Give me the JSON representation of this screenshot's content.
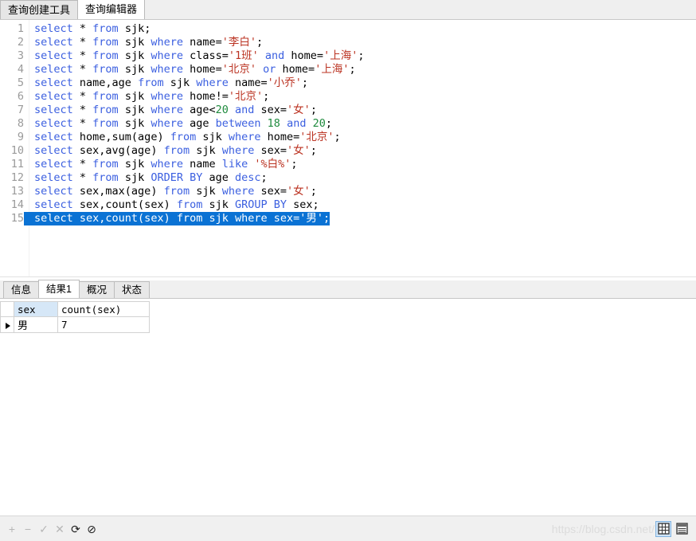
{
  "window": {
    "tabs": [
      {
        "label": "查询创建工具",
        "active": false
      },
      {
        "label": "查询编辑器",
        "active": true
      }
    ]
  },
  "editor": {
    "selected_line": 15,
    "lines": [
      {
        "n": "1",
        "tokens": [
          {
            "t": "select",
            "c": "kw"
          },
          {
            "t": " * ",
            "c": "pln"
          },
          {
            "t": "from",
            "c": "kw"
          },
          {
            "t": " sjk;",
            "c": "pln"
          }
        ]
      },
      {
        "n": "2",
        "tokens": [
          {
            "t": "select",
            "c": "kw"
          },
          {
            "t": " * ",
            "c": "pln"
          },
          {
            "t": "from",
            "c": "kw"
          },
          {
            "t": " sjk ",
            "c": "pln"
          },
          {
            "t": "where",
            "c": "kw"
          },
          {
            "t": " name=",
            "c": "pln"
          },
          {
            "t": "'李白'",
            "c": "str"
          },
          {
            "t": ";",
            "c": "pln"
          }
        ]
      },
      {
        "n": "3",
        "tokens": [
          {
            "t": "select",
            "c": "kw"
          },
          {
            "t": " * ",
            "c": "pln"
          },
          {
            "t": "from",
            "c": "kw"
          },
          {
            "t": " sjk ",
            "c": "pln"
          },
          {
            "t": "where",
            "c": "kw"
          },
          {
            "t": " class=",
            "c": "pln"
          },
          {
            "t": "'1班'",
            "c": "str"
          },
          {
            "t": " ",
            "c": "pln"
          },
          {
            "t": "and",
            "c": "kw"
          },
          {
            "t": " home=",
            "c": "pln"
          },
          {
            "t": "'上海'",
            "c": "str"
          },
          {
            "t": ";",
            "c": "pln"
          }
        ]
      },
      {
        "n": "4",
        "tokens": [
          {
            "t": "select",
            "c": "kw"
          },
          {
            "t": " * ",
            "c": "pln"
          },
          {
            "t": "from",
            "c": "kw"
          },
          {
            "t": " sjk ",
            "c": "pln"
          },
          {
            "t": "where",
            "c": "kw"
          },
          {
            "t": " home=",
            "c": "pln"
          },
          {
            "t": "'北京'",
            "c": "str"
          },
          {
            "t": " ",
            "c": "pln"
          },
          {
            "t": "or",
            "c": "kw"
          },
          {
            "t": " home=",
            "c": "pln"
          },
          {
            "t": "'上海'",
            "c": "str"
          },
          {
            "t": ";",
            "c": "pln"
          }
        ]
      },
      {
        "n": "5",
        "tokens": [
          {
            "t": "select",
            "c": "kw"
          },
          {
            "t": " name,age ",
            "c": "pln"
          },
          {
            "t": "from",
            "c": "kw"
          },
          {
            "t": " sjk ",
            "c": "pln"
          },
          {
            "t": "where",
            "c": "kw"
          },
          {
            "t": " name=",
            "c": "pln"
          },
          {
            "t": "'小乔'",
            "c": "str"
          },
          {
            "t": ";",
            "c": "pln"
          }
        ]
      },
      {
        "n": "6",
        "tokens": [
          {
            "t": "select",
            "c": "kw"
          },
          {
            "t": " * ",
            "c": "pln"
          },
          {
            "t": "from",
            "c": "kw"
          },
          {
            "t": " sjk ",
            "c": "pln"
          },
          {
            "t": "where",
            "c": "kw"
          },
          {
            "t": " home!=",
            "c": "pln"
          },
          {
            "t": "'北京'",
            "c": "str"
          },
          {
            "t": ";",
            "c": "pln"
          }
        ]
      },
      {
        "n": "7",
        "tokens": [
          {
            "t": "select",
            "c": "kw"
          },
          {
            "t": " * ",
            "c": "pln"
          },
          {
            "t": "from",
            "c": "kw"
          },
          {
            "t": " sjk ",
            "c": "pln"
          },
          {
            "t": "where",
            "c": "kw"
          },
          {
            "t": " age<",
            "c": "pln"
          },
          {
            "t": "20",
            "c": "num"
          },
          {
            "t": " ",
            "c": "pln"
          },
          {
            "t": "and",
            "c": "kw"
          },
          {
            "t": " sex=",
            "c": "pln"
          },
          {
            "t": "'女'",
            "c": "str"
          },
          {
            "t": ";",
            "c": "pln"
          }
        ]
      },
      {
        "n": "8",
        "tokens": [
          {
            "t": "select",
            "c": "kw"
          },
          {
            "t": " * ",
            "c": "pln"
          },
          {
            "t": "from",
            "c": "kw"
          },
          {
            "t": " sjk ",
            "c": "pln"
          },
          {
            "t": "where",
            "c": "kw"
          },
          {
            "t": " age ",
            "c": "pln"
          },
          {
            "t": "between",
            "c": "kw"
          },
          {
            "t": " ",
            "c": "pln"
          },
          {
            "t": "18",
            "c": "num"
          },
          {
            "t": " ",
            "c": "pln"
          },
          {
            "t": "and",
            "c": "kw"
          },
          {
            "t": " ",
            "c": "pln"
          },
          {
            "t": "20",
            "c": "num"
          },
          {
            "t": ";",
            "c": "pln"
          }
        ]
      },
      {
        "n": "9",
        "tokens": [
          {
            "t": "select",
            "c": "kw"
          },
          {
            "t": " home,sum(age) ",
            "c": "pln"
          },
          {
            "t": "from",
            "c": "kw"
          },
          {
            "t": " sjk ",
            "c": "pln"
          },
          {
            "t": "where",
            "c": "kw"
          },
          {
            "t": " home=",
            "c": "pln"
          },
          {
            "t": "'北京'",
            "c": "str"
          },
          {
            "t": ";",
            "c": "pln"
          }
        ]
      },
      {
        "n": "10",
        "tokens": [
          {
            "t": "select",
            "c": "kw"
          },
          {
            "t": " sex,avg(age) ",
            "c": "pln"
          },
          {
            "t": "from",
            "c": "kw"
          },
          {
            "t": " sjk ",
            "c": "pln"
          },
          {
            "t": "where",
            "c": "kw"
          },
          {
            "t": " sex=",
            "c": "pln"
          },
          {
            "t": "'女'",
            "c": "str"
          },
          {
            "t": ";",
            "c": "pln"
          }
        ]
      },
      {
        "n": "11",
        "tokens": [
          {
            "t": "select",
            "c": "kw"
          },
          {
            "t": " * ",
            "c": "pln"
          },
          {
            "t": "from",
            "c": "kw"
          },
          {
            "t": " sjk ",
            "c": "pln"
          },
          {
            "t": "where",
            "c": "kw"
          },
          {
            "t": " name ",
            "c": "pln"
          },
          {
            "t": "like",
            "c": "kw"
          },
          {
            "t": " ",
            "c": "pln"
          },
          {
            "t": "'%白%'",
            "c": "str"
          },
          {
            "t": ";",
            "c": "pln"
          }
        ]
      },
      {
        "n": "12",
        "tokens": [
          {
            "t": "select",
            "c": "kw"
          },
          {
            "t": " * ",
            "c": "pln"
          },
          {
            "t": "from",
            "c": "kw"
          },
          {
            "t": " sjk ",
            "c": "pln"
          },
          {
            "t": "ORDER BY",
            "c": "kw"
          },
          {
            "t": " age ",
            "c": "pln"
          },
          {
            "t": "desc",
            "c": "kw"
          },
          {
            "t": ";",
            "c": "pln"
          }
        ]
      },
      {
        "n": "13",
        "tokens": [
          {
            "t": "select",
            "c": "kw"
          },
          {
            "t": " sex,max(age) ",
            "c": "pln"
          },
          {
            "t": "from",
            "c": "kw"
          },
          {
            "t": " sjk ",
            "c": "pln"
          },
          {
            "t": "where",
            "c": "kw"
          },
          {
            "t": " sex=",
            "c": "pln"
          },
          {
            "t": "'女'",
            "c": "str"
          },
          {
            "t": ";",
            "c": "pln"
          }
        ]
      },
      {
        "n": "14",
        "tokens": [
          {
            "t": "select",
            "c": "kw"
          },
          {
            "t": " sex,count(sex) ",
            "c": "pln"
          },
          {
            "t": "from",
            "c": "kw"
          },
          {
            "t": " sjk ",
            "c": "pln"
          },
          {
            "t": "GROUP BY",
            "c": "kw"
          },
          {
            "t": " sex;",
            "c": "pln"
          }
        ]
      },
      {
        "n": "15",
        "tokens": [
          {
            "t": "select",
            "c": "kw"
          },
          {
            "t": " sex,count(sex) ",
            "c": "pln"
          },
          {
            "t": "from",
            "c": "kw"
          },
          {
            "t": " sjk ",
            "c": "pln"
          },
          {
            "t": "where",
            "c": "kw"
          },
          {
            "t": " sex=",
            "c": "pln"
          },
          {
            "t": "'男'",
            "c": "str"
          },
          {
            "t": ";",
            "c": "pln"
          }
        ]
      }
    ]
  },
  "results": {
    "tabs": [
      {
        "label": "信息",
        "active": false
      },
      {
        "label": "结果1",
        "active": true
      },
      {
        "label": "概况",
        "active": false
      },
      {
        "label": "状态",
        "active": false
      }
    ],
    "grid": {
      "columns": [
        "sex",
        "count(sex)"
      ],
      "selected_column": "sex",
      "rows": [
        {
          "indicator": "current-row",
          "sex": "男",
          "count(sex)": "7"
        }
      ]
    }
  },
  "bottom_toolbar": {
    "buttons": [
      {
        "name": "add-record-button",
        "glyph": "+",
        "enabled": false
      },
      {
        "name": "delete-record-button",
        "glyph": "−",
        "enabled": false
      },
      {
        "name": "apply-change-button",
        "glyph": "✓",
        "enabled": false
      },
      {
        "name": "cancel-change-button",
        "glyph": "✕",
        "enabled": false
      },
      {
        "name": "refresh-button",
        "glyph": "⟳",
        "enabled": true
      },
      {
        "name": "stop-button",
        "glyph": "⊘",
        "enabled": true
      }
    ],
    "view_modes": [
      {
        "name": "grid-view-button",
        "selected": true
      },
      {
        "name": "form-view-button",
        "selected": false
      }
    ],
    "watermark": "https://blog.csdn.net/"
  },
  "colors": {
    "keyword": "#3b5fe0",
    "string": "#bb3322",
    "number": "#1f8b3e",
    "selection": "#0a72d4",
    "selected_header": "#d6e7f7"
  }
}
